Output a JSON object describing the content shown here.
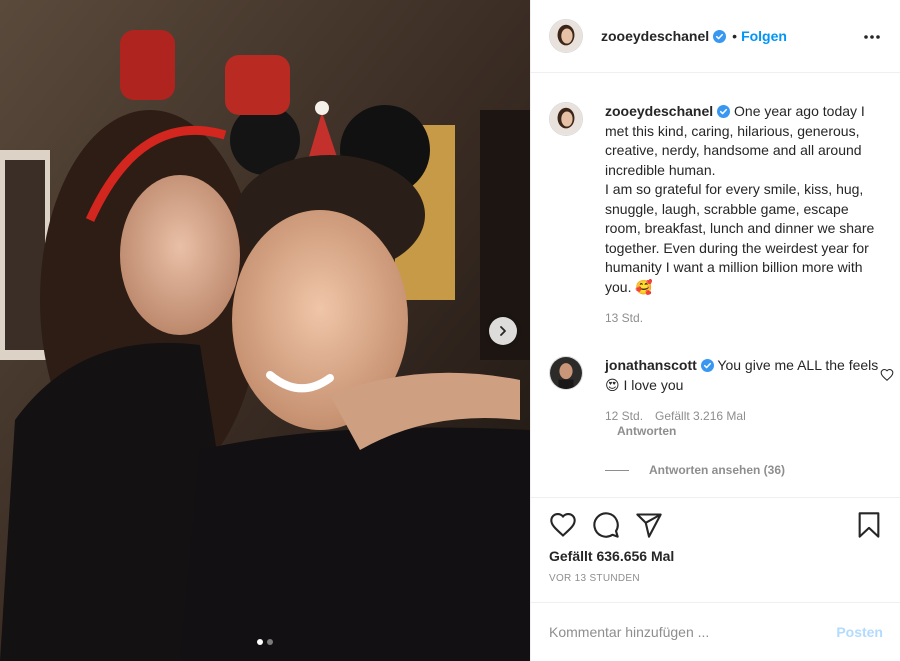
{
  "header": {
    "username": "zooeydeschanel",
    "separator": "•",
    "follow_label": "Folgen"
  },
  "caption": {
    "author": "zooeydeschanel",
    "text": "One year ago today I met this kind, caring, hilarious, generous, creative, nerdy, handsome and all around incredible human.",
    "text2": "I am so grateful for every smile, kiss, hug, snuggle, laugh, scrabble game, escape room, breakfast, lunch and dinner we share together. Even during the weirdest year for humanity I want a million billion more with you. 🥰",
    "time": "13 Std."
  },
  "comment": {
    "author": "jonathanscott",
    "text": "You give me ALL the feels 😍 I love you",
    "time": "12 Std.",
    "likes": "Gefällt 3.216 Mal",
    "reply_label": "Antworten"
  },
  "view_replies": "Antworten ansehen (36)",
  "actions": {
    "likes": "Gefällt 636.656 Mal",
    "timestamp": "VOR 13 STUNDEN"
  },
  "add_comment": {
    "placeholder": "Kommentar hinzufügen ...",
    "post_label": "Posten"
  },
  "carousel": {
    "slide_count": 2,
    "current_slide": 1
  },
  "colors": {
    "link_blue": "#0095f6",
    "disabled_blue": "#b3dbff",
    "verified_blue": "#3897f0",
    "secondary_text": "#8e8e8e"
  },
  "icons": {
    "more": "more-horizontal-icon",
    "like": "heart-icon",
    "comment": "comment-bubble-icon",
    "share": "paper-plane-icon",
    "save": "bookmark-icon",
    "next": "chevron-right-icon",
    "verified": "verified-badge-icon"
  }
}
